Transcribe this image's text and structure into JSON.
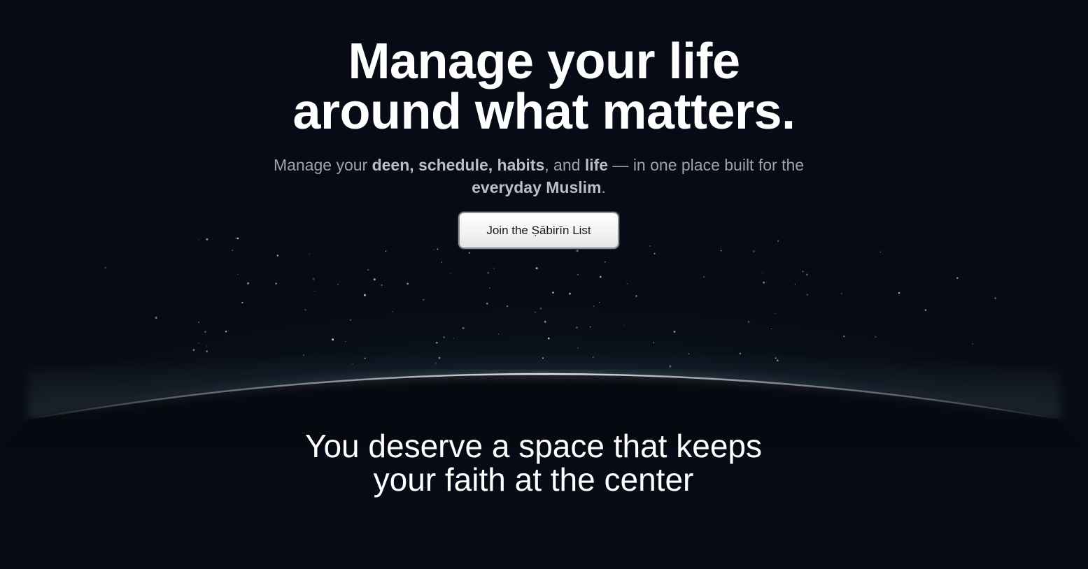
{
  "hero": {
    "headline_line1": "Manage your life",
    "headline_line2": "around what matters.",
    "subhead": {
      "t1": "Manage your ",
      "b1": "deen, schedule, habits",
      "t2": ", and ",
      "b2": "life",
      "t3": " — in one place built for the ",
      "b3": "everyday Muslim",
      "t4": "."
    },
    "cta_label": "Join the Ṣābirīn List"
  },
  "section": {
    "title": "You deserve a space that keeps your faith at the center"
  },
  "colors": {
    "background": "#070b15",
    "headline": "#ffffff",
    "subhead": "#9ca2ae",
    "glow": "#2a6b6b"
  }
}
